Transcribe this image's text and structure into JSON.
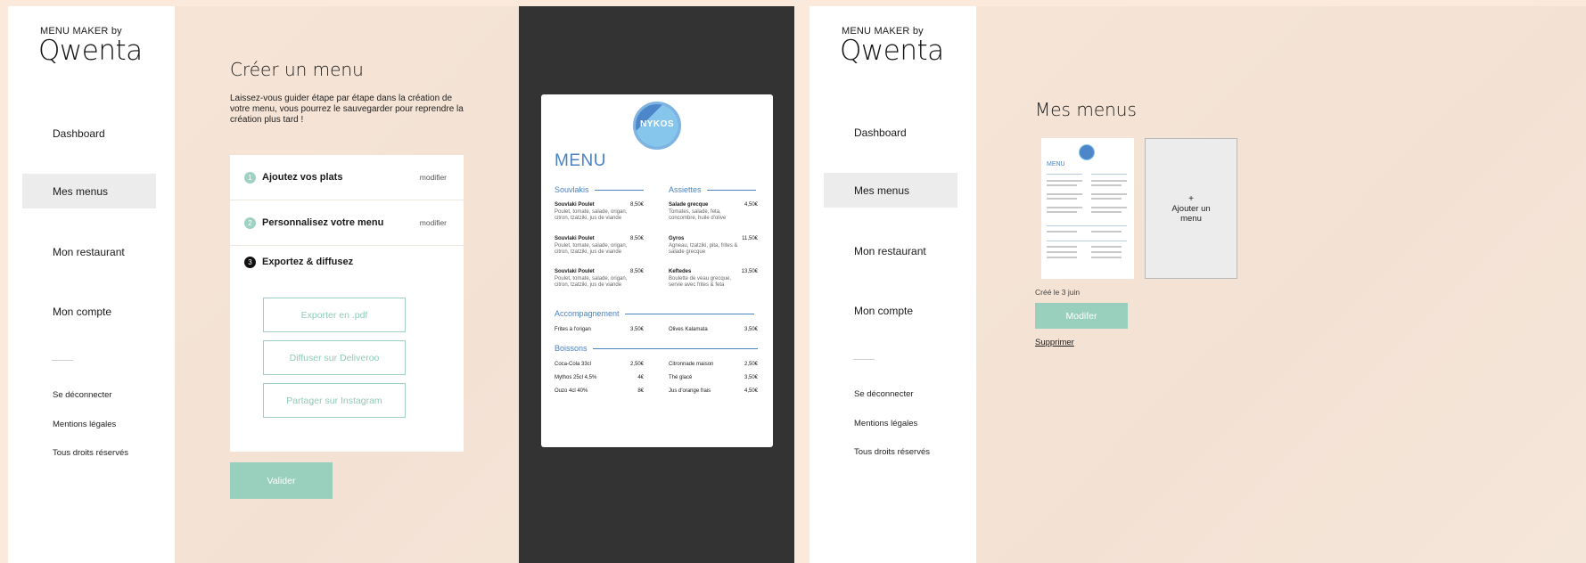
{
  "brand": {
    "top": "MENU MAKER by",
    "logo": "Qwenta"
  },
  "nav": {
    "dashboard": "Dashboard",
    "my_menus": "Mes menus",
    "my_restaurant": "Mon restaurant",
    "my_account": "Mon compte",
    "logout": "Se déconnecter",
    "legal": "Mentions légales",
    "rights": "Tous droits réservés"
  },
  "create": {
    "title": "Créer un menu",
    "lead": "Laissez-vous guider étape par étape dans la création de votre menu, vous pourrez le sauvegarder pour reprendre la création plus tard !",
    "steps": [
      {
        "num": "1",
        "label": "Ajoutez vos plats",
        "edit": "modifier"
      },
      {
        "num": "2",
        "label": "Personnalisez votre menu",
        "edit": "modifier"
      },
      {
        "num": "3",
        "label": "Exportez & diffusez"
      }
    ],
    "actions": [
      "Exporter en .pdf",
      "Diffuser sur Deliveroo",
      "Partager sur Instagram"
    ],
    "validate": "Valider"
  },
  "preview": {
    "logo_text": "NYKOS",
    "title": "MENU",
    "sections": {
      "souvlakis": "Souvlakis",
      "assiettes": "Assiettes",
      "accompagnement": "Accompagnement",
      "boissons": "Boissons"
    },
    "souvlakis": [
      {
        "name": "Souvlaki Poulet",
        "price": "8,50€",
        "desc": "Poulet, tomate, salade, origan, citron, tzatziki, jus de viande"
      },
      {
        "name": "Souvlaki Poulet",
        "price": "8,50€",
        "desc": "Poulet, tomate, salade, origan, citron, tzatziki, jus de viande"
      },
      {
        "name": "Souvlaki Poulet",
        "price": "8,50€",
        "desc": "Poulet, tomate, salade, origan, citron, tzatziki, jus de viande"
      }
    ],
    "assiettes": [
      {
        "name": "Salade grecque",
        "price": "4,50€",
        "desc": "Tomates, salade, feta, concombre, huile d'olive"
      },
      {
        "name": "Gyros",
        "price": "11,50€",
        "desc": "Agneau, tzatziki, pita, frites & salade grecque"
      },
      {
        "name": "Keftedes",
        "price": "13,50€",
        "desc": "Boulette de veau grecque, servie avec frites & feta"
      }
    ],
    "accompagnement": [
      {
        "name": "Frites à l'origan",
        "price": "3,50€"
      },
      {
        "name": "Olives Kalamata",
        "price": "3,50€"
      }
    ],
    "boissons_left": [
      {
        "name": "Coca-Cola 33cl",
        "price": "2,50€"
      },
      {
        "name": "Mythos 25cl 4,5%",
        "price": "4€"
      },
      {
        "name": "Ouzo 4cl 40%",
        "price": "8€"
      }
    ],
    "boissons_right": [
      {
        "name": "Citronnade maison",
        "price": "2,50€"
      },
      {
        "name": "Thé glacé",
        "price": "3,50€"
      },
      {
        "name": "Jus d'orange frais",
        "price": "4,50€"
      }
    ]
  },
  "my_menus": {
    "title": "Mes menus",
    "add_plus": "+",
    "add_label": "Ajouter un menu",
    "created": "Créé le 3 juin",
    "edit": "Modifer",
    "delete": "Supprimer"
  },
  "colors": {
    "accent": "#99cfbd",
    "menu_blue": "#4a82c2",
    "preview_bg": "#333333",
    "page_bg": "#f5e6da"
  }
}
